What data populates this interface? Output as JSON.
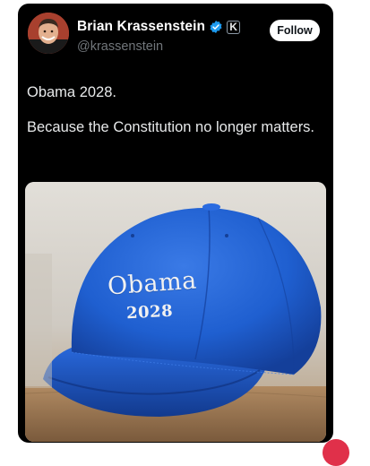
{
  "author": {
    "display_name": "Brian Krassenstein",
    "handle": "@krassenstein",
    "verified_icon": "verified-badge-icon",
    "affiliate_badge": "K"
  },
  "follow_button": {
    "label": "Follow"
  },
  "tweet": {
    "line1": "Obama 2028.",
    "line2": "Because the Constitution no longer matters."
  },
  "media": {
    "description_icon": "photo-of-blue-cap",
    "cap_text_line1": "Obama",
    "cap_text_line2": "2028"
  },
  "colors": {
    "card_background": "#000000",
    "verified_blue": "#1d9bf0",
    "cap_blue": "#1f5fd0",
    "text_primary": "#e7e9ea",
    "text_secondary": "#71767b"
  }
}
